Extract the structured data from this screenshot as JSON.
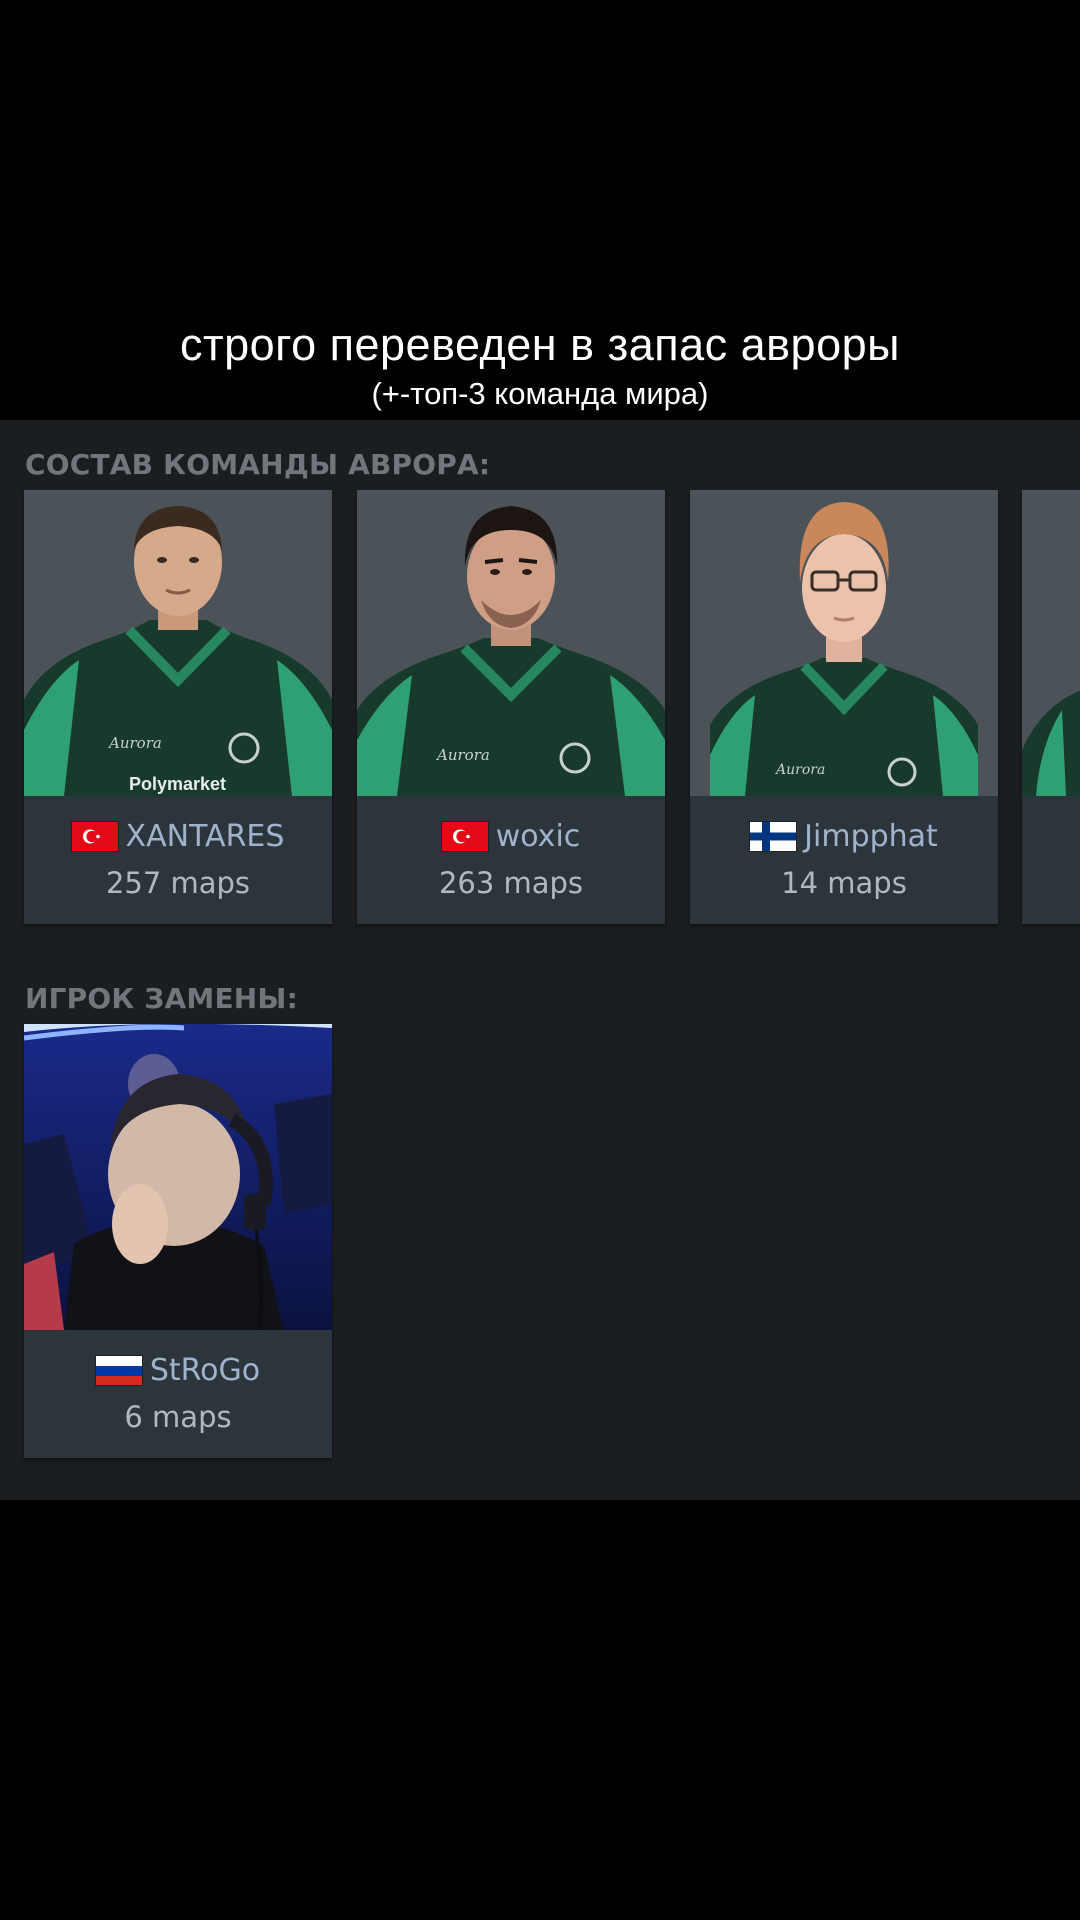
{
  "caption": {
    "line1": "строго переведен в запас авроры",
    "line2": "(+-топ-3 команда мира)"
  },
  "roster": {
    "heading": "СОСТАВ КОМАНДЫ АВРОРА:",
    "players": [
      {
        "name": "XANTARES",
        "maps": "257 maps",
        "flag": "turkey-flag-icon",
        "photo_text": "Polymarket"
      },
      {
        "name": "woxic",
        "maps": "263 maps",
        "flag": "turkey-flag-icon"
      },
      {
        "name": "Jimpphat",
        "maps": "14 maps",
        "flag": "finland-flag-icon"
      }
    ]
  },
  "substitute": {
    "heading": "ИГРОК ЗАМЕНЫ:",
    "player": {
      "name": "StRoGo",
      "maps": "6 maps",
      "flag": "russia-flag-icon"
    }
  },
  "colors": {
    "panel_bg": "#1b1e21",
    "card_bg": "#2d353c",
    "name_color": "#9fb4cc",
    "heading_color": "#70767b",
    "jersey_green": "#0f5c3c"
  }
}
